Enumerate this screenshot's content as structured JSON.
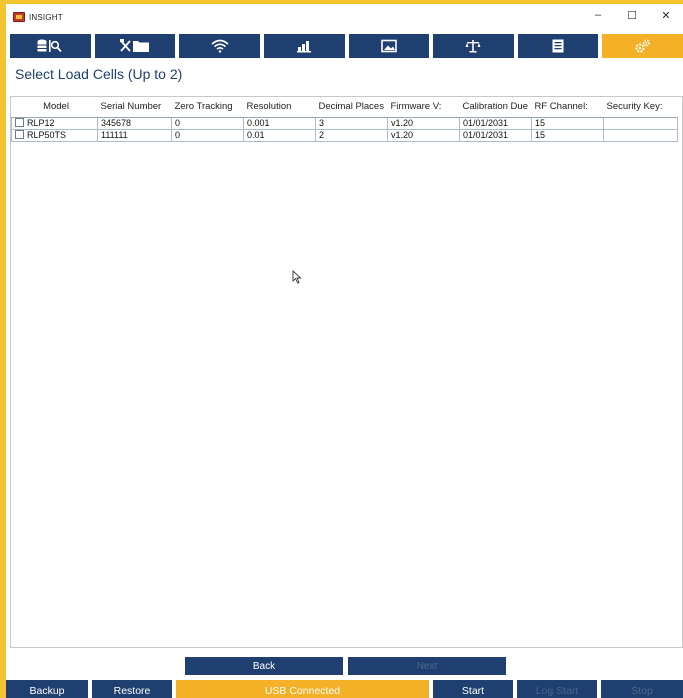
{
  "window": {
    "title": "INSIGHT",
    "minimize": "–",
    "maximize": "☐",
    "close": "✕"
  },
  "heading": "Select Load Cells (Up to 2)",
  "table": {
    "columns": [
      "Model",
      "Serial Number",
      "Zero Tracking",
      "Resolution",
      "Decimal Places",
      "Firmware V:",
      "Calibration Due",
      "RF Channel:",
      "Security Key:"
    ],
    "rows": [
      [
        "RLP12",
        "345678",
        "0",
        "0.001",
        "3",
        "v1.20",
        "01/01/2031",
        "15",
        ""
      ],
      [
        "RLP50TS",
        "111111",
        "0",
        "0.01",
        "2",
        "v1.20",
        "01/01/2031",
        "15",
        ""
      ]
    ]
  },
  "nav": {
    "back": "Back",
    "next": "Next"
  },
  "bottom": {
    "backup": "Backup",
    "restore": "Restore",
    "status": "USB Connected",
    "start": "Start",
    "log_start": "Log Start",
    "stop": "Stop"
  },
  "tabs": [
    {
      "icon": "database-search-icon"
    },
    {
      "icon": "tools-folder-icon"
    },
    {
      "icon": "wifi-icon"
    },
    {
      "icon": "chart-up-icon"
    },
    {
      "icon": "image-icon"
    },
    {
      "icon": "scale-icon"
    },
    {
      "icon": "document-icon"
    },
    {
      "icon": "gears-icon"
    }
  ],
  "colors": {
    "primary": "#1f3f70",
    "accent": "#f4b026"
  }
}
